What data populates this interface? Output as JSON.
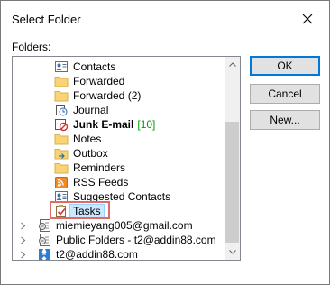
{
  "dialog": {
    "title": "Select Folder",
    "folders_label": "Folders:"
  },
  "buttons": {
    "ok": "OK",
    "cancel": "Cancel",
    "new": "New..."
  },
  "tree": {
    "items": [
      {
        "label": "Contacts",
        "icon": "contacts-icon"
      },
      {
        "label": "Forwarded",
        "icon": "folder-icon"
      },
      {
        "label": "Forwarded (2)",
        "icon": "folder-icon"
      },
      {
        "label": "Journal",
        "icon": "journal-icon"
      },
      {
        "label": "Junk E-mail",
        "icon": "junk-email-icon",
        "count": "[10]"
      },
      {
        "label": "Notes",
        "icon": "folder-icon"
      },
      {
        "label": "Outbox",
        "icon": "outbox-icon"
      },
      {
        "label": "Reminders",
        "icon": "folder-icon"
      },
      {
        "label": "RSS Feeds",
        "icon": "rss-icon"
      },
      {
        "label": "Suggested Contacts",
        "icon": "contacts-icon"
      },
      {
        "label": "Tasks",
        "icon": "tasks-icon",
        "selected": true
      },
      {
        "label": "miemieyang005@gmail.com",
        "icon": "data-file-icon"
      },
      {
        "label": "Public Folders - t2@addin88.com",
        "icon": "data-file-icon"
      },
      {
        "label": "t2@addin88.com",
        "icon": "exchange-icon"
      }
    ]
  },
  "colors": {
    "folder": "#f8d475",
    "selection": "#cce8ff",
    "highlight_border": "#e06a6a",
    "default_button_border": "#0078d7",
    "count": "#00a000"
  }
}
